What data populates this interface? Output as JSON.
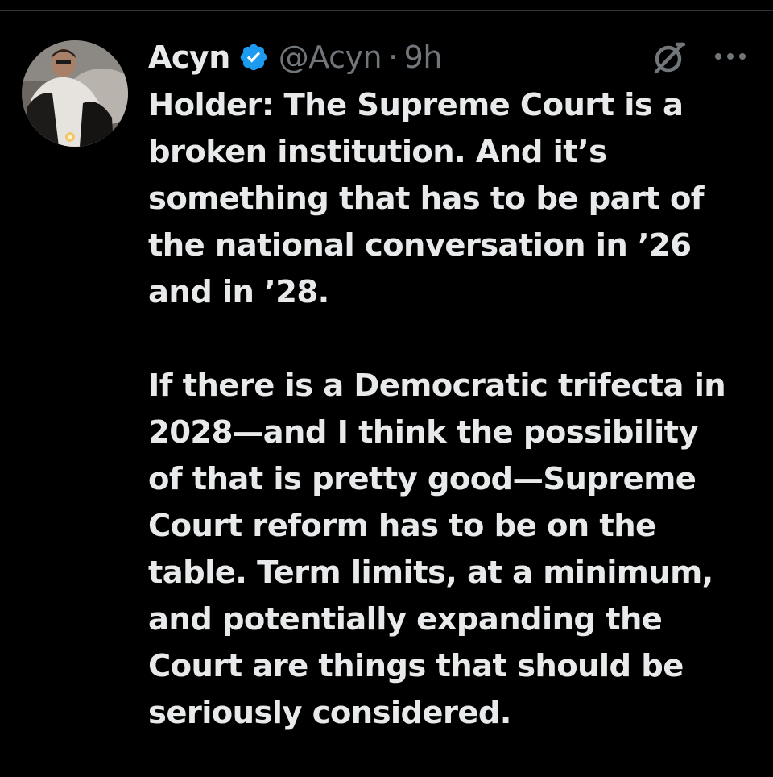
{
  "tweet": {
    "author": {
      "display_name": "Acyn",
      "handle": "@Acyn",
      "verified_icon": "verified-badge-icon",
      "avatar": "user-avatar-photo"
    },
    "separator": "·",
    "time": "9h",
    "actions": {
      "grok_icon": "grok-icon",
      "more_icon": "more-horizontal-icon"
    },
    "text": "Holder: The Supreme Court is a\nbroken institution. And it’s\nsomething that has to be part of\nthe national conversation in ’26\nand in ’28.\n\nIf there is a Democratic trifecta in\n2028—and I think the possibility\nof that is pretty good—Supreme\nCourt reform has to be on the\ntable. Term limits, at a minimum,\nand potentially expanding the\nCourt are things that should be\nseriously considered."
  },
  "colors": {
    "background": "#000000",
    "primary_text": "#e7e9ea",
    "secondary_text": "#71767b",
    "verified_blue": "#1d9bf0"
  }
}
